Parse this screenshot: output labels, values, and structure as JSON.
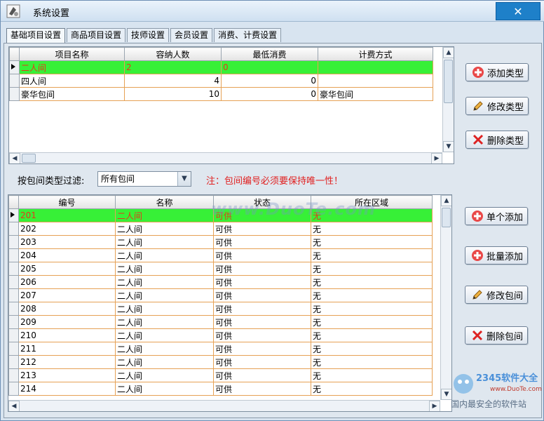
{
  "window": {
    "title": "系统设置",
    "close": "✕"
  },
  "tabs": [
    "基础项目设置",
    "商品项目设置",
    "技师设置",
    "会员设置",
    "消费、计费设置"
  ],
  "type_table": {
    "headers": [
      "项目名称",
      "容纳人数",
      "最低消费",
      "计费方式"
    ],
    "rows": [
      [
        "二人间",
        "2",
        "0",
        ""
      ],
      [
        "四人间",
        "4",
        "0",
        ""
      ],
      [
        "豪华包间",
        "10",
        "0",
        "豪华包间"
      ]
    ]
  },
  "type_buttons": {
    "add": "添加类型",
    "edit": "修改类型",
    "delete": "删除类型"
  },
  "filter": {
    "label": "按包间类型过滤:",
    "value": "所有包间",
    "note": "注：包间编号必须要保持唯一性！"
  },
  "room_table": {
    "headers": [
      "编号",
      "名称",
      "状态",
      "所在区域"
    ],
    "rows": [
      [
        "201",
        "二人间",
        "可供",
        "无"
      ],
      [
        "202",
        "二人间",
        "可供",
        "无"
      ],
      [
        "203",
        "二人间",
        "可供",
        "无"
      ],
      [
        "204",
        "二人间",
        "可供",
        "无"
      ],
      [
        "205",
        "二人间",
        "可供",
        "无"
      ],
      [
        "206",
        "二人间",
        "可供",
        "无"
      ],
      [
        "207",
        "二人间",
        "可供",
        "无"
      ],
      [
        "208",
        "二人间",
        "可供",
        "无"
      ],
      [
        "209",
        "二人间",
        "可供",
        "无"
      ],
      [
        "210",
        "二人间",
        "可供",
        "无"
      ],
      [
        "211",
        "二人间",
        "可供",
        "无"
      ],
      [
        "212",
        "二人间",
        "可供",
        "无"
      ],
      [
        "213",
        "二人间",
        "可供",
        "无"
      ],
      [
        "214",
        "二人间",
        "可供",
        "无"
      ]
    ]
  },
  "room_buttons": {
    "single_add": "单个添加",
    "batch_add": "批量添加",
    "edit": "修改包间",
    "delete": "删除包间"
  },
  "watermark": "www.DuoTe.com",
  "logo": {
    "brand": "2345软件大全",
    "url": "www.DuoTe.com",
    "slogan": "国内最安全的软件站"
  }
}
